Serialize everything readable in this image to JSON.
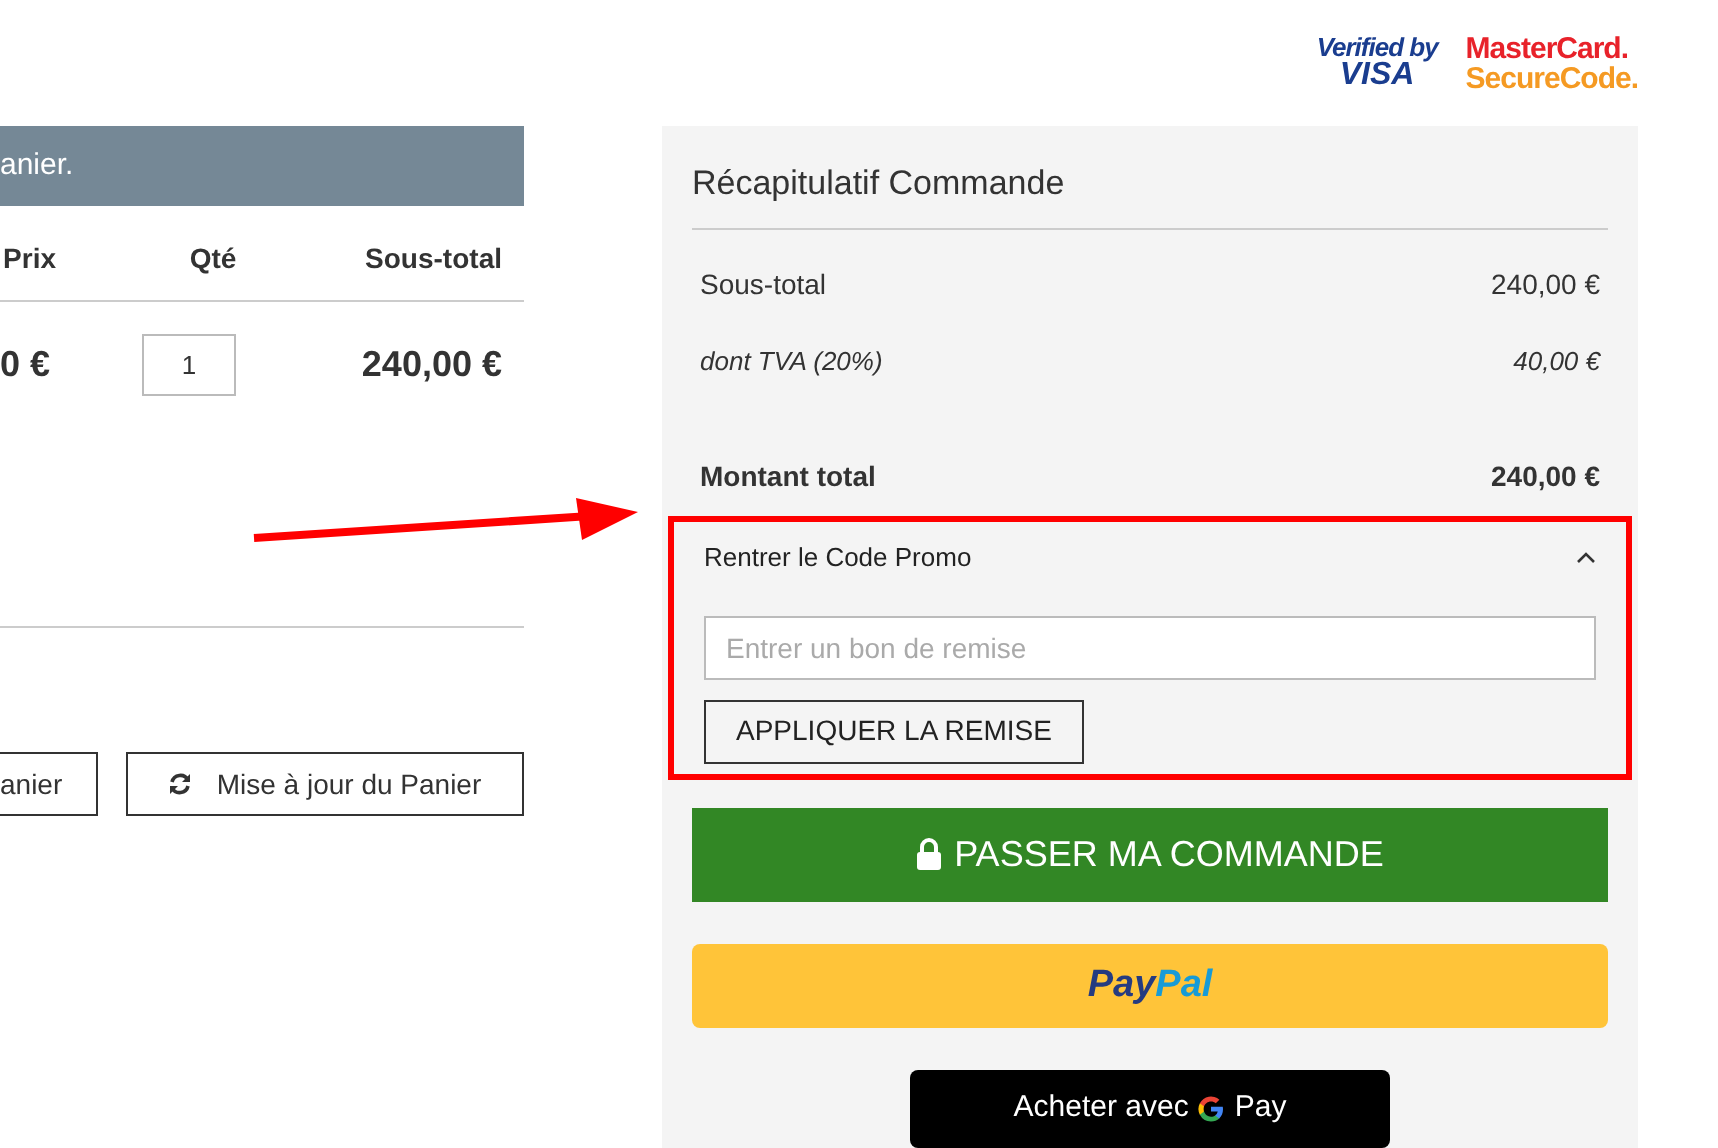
{
  "badges": {
    "visa": {
      "line1": "Verified by",
      "line2": "VISA"
    },
    "mastercard": {
      "line1": "MasterCard.",
      "line2": "SecureCode."
    }
  },
  "cart": {
    "notice": "anier.",
    "columns": [
      "Prix",
      "Qté",
      "Sous-total"
    ],
    "rows": [
      {
        "price": "0 €",
        "quantity": "1",
        "subtotal": "240,00 €"
      }
    ],
    "buttons": [
      {
        "label": "anier",
        "kind": "plain"
      },
      {
        "label": "Mise à jour du Panier",
        "kind": "refresh"
      }
    ]
  },
  "summary": {
    "title": "Récapitulatif Commande",
    "rows": [
      {
        "label": "Sous-total",
        "value": "240,00 €",
        "kind": "normal"
      },
      {
        "label": "dont TVA (20%)",
        "value": "40,00 €",
        "kind": "tax"
      },
      {
        "label": "Montant total",
        "value": "240,00 €",
        "kind": "total"
      }
    ],
    "promo": {
      "title": "Rentrer le Code Promo",
      "expanded": true,
      "placeholder": "Entrer un bon de remise",
      "button": "APPLIQUER LA REMISE"
    },
    "checkout_button": "PASSER MA COMMANDE",
    "paypal": [
      "Pay",
      "Pal"
    ],
    "gpay": {
      "prefix": "Acheter avec",
      "suffix": "Pay"
    }
  }
}
